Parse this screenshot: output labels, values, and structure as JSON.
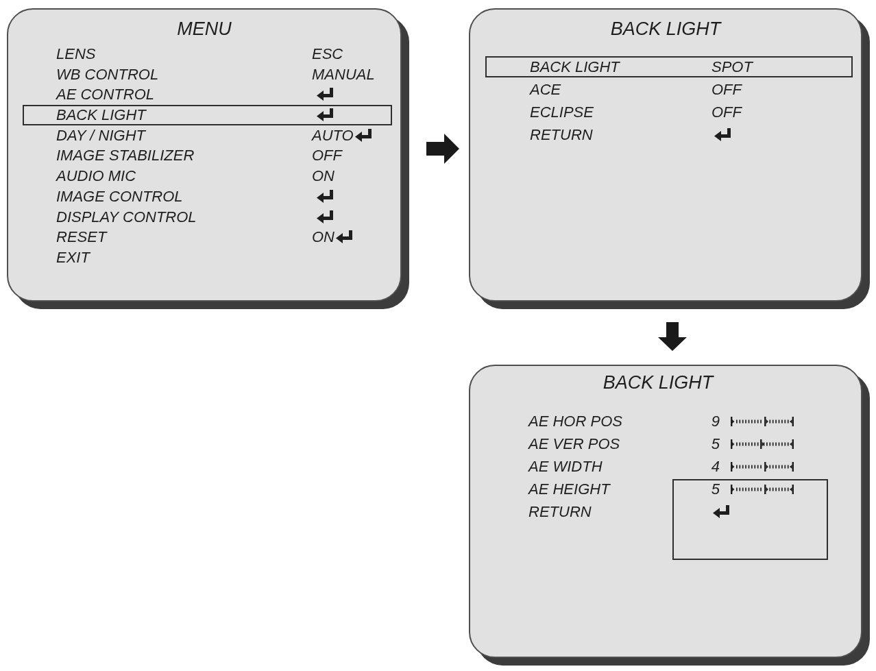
{
  "main_menu": {
    "title": "MENU",
    "items": [
      {
        "label": "LENS",
        "value": "ESC",
        "enter": false,
        "selected": false
      },
      {
        "label": "WB CONTROL",
        "value": "MANUAL",
        "enter": false,
        "selected": false
      },
      {
        "label": "AE CONTROL",
        "enter": true,
        "selected": false
      },
      {
        "label": "BACK LIGHT",
        "enter": true,
        "selected": true
      },
      {
        "label": "DAY / NIGHT",
        "value": "AUTO",
        "enter": true,
        "selected": false
      },
      {
        "label": "IMAGE STABILIZER",
        "value": "OFF",
        "enter": false,
        "selected": false
      },
      {
        "label": "AUDIO MIC",
        "value": "ON",
        "enter": false,
        "selected": false
      },
      {
        "label": "IMAGE CONTROL",
        "enter": true,
        "selected": false
      },
      {
        "label": "DISPLAY CONTROL",
        "enter": true,
        "selected": false
      },
      {
        "label": "RESET",
        "value": "ON",
        "enter": true,
        "selected": false
      },
      {
        "label": "EXIT",
        "enter": false,
        "selected": false
      }
    ]
  },
  "backlight_menu": {
    "title": "BACK LIGHT",
    "items": [
      {
        "label": "BACK LIGHT",
        "value": "SPOT",
        "enter": false,
        "selected": true
      },
      {
        "label": "ACE",
        "value": "OFF",
        "enter": false,
        "selected": false
      },
      {
        "label": "ECLIPSE",
        "value": "OFF",
        "enter": false,
        "selected": false
      },
      {
        "label": "RETURN",
        "enter": true,
        "selected": false
      }
    ]
  },
  "spot_menu": {
    "title": "BACK LIGHT",
    "items": [
      {
        "kind": "gauge",
        "label": "AE HOR POS",
        "value": "9",
        "level": 0.55
      },
      {
        "kind": "gauge",
        "label": "AE VER POS",
        "value": "5",
        "level": 0.48
      },
      {
        "kind": "gauge",
        "label": "AE WIDTH",
        "value": "4",
        "level": 0.55
      },
      {
        "kind": "gauge",
        "label": "AE HEIGHT",
        "value": "5",
        "level": 0.55
      },
      {
        "kind": "enter",
        "label": "RETURN"
      }
    ]
  }
}
